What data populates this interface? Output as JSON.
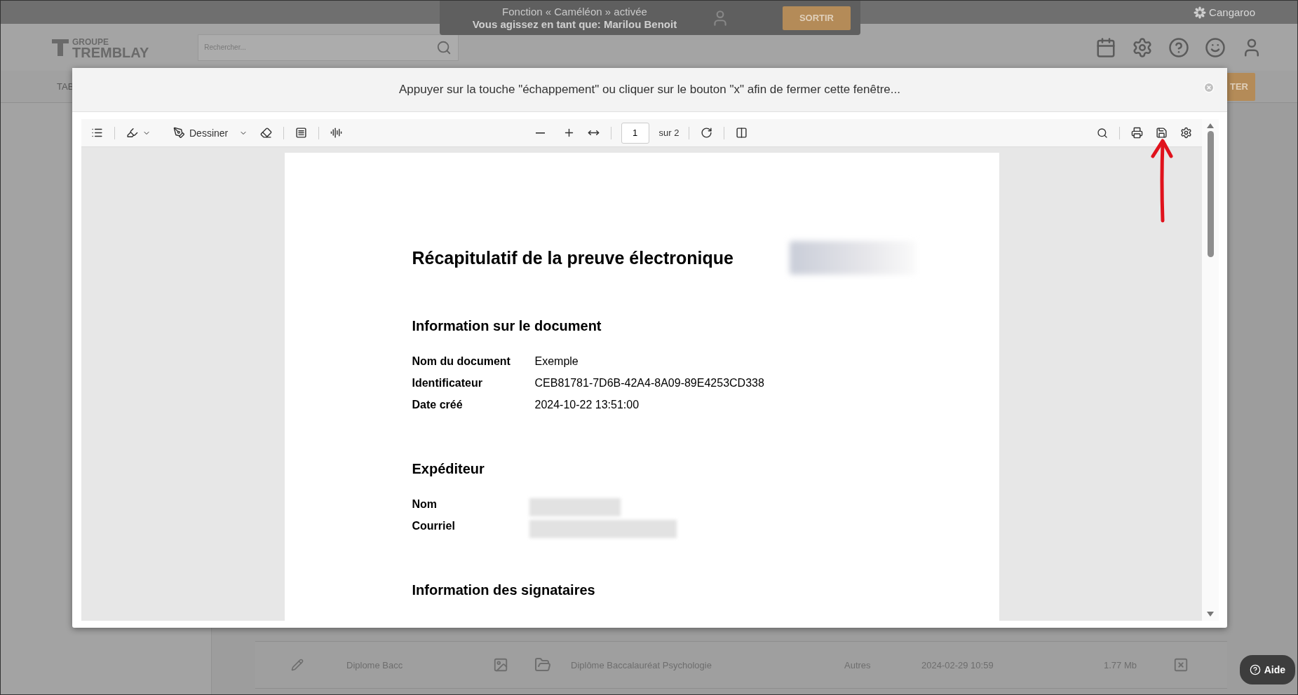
{
  "impersonation_banner": {
    "title": "Fonction « Caméléon » activée",
    "subtitle": "Vous agissez en tant que: Marilou Benoit",
    "button": "SORTIR"
  },
  "brand": "Cangaroo",
  "header": {
    "logo_top": "GROUPE",
    "logo_bottom": "TREMBLAY",
    "search": {
      "placeholder": "Rechercher..."
    }
  },
  "nav": {
    "tab_partial": "TAB",
    "action_partial": "TER"
  },
  "background_row": {
    "name": "Diplome Bacc",
    "description": "Diplôme Baccalauréat Psychologie",
    "category": "Autres",
    "date": "2024-02-29 10:59",
    "size": "1.77 Mb"
  },
  "help_button": "Aide",
  "modal": {
    "hint": "Appuyer sur la touche \"échappement\" ou cliquer sur le bouton \"x\" afin de fermer cette fenêtre...",
    "toolbar": {
      "draw_label": "Dessiner",
      "page_number": "1",
      "page_total": "sur 2"
    },
    "document": {
      "title": "Récapitulatif de la preuve électronique",
      "sections": [
        {
          "heading": "Information sur le document",
          "rows": [
            {
              "label": "Nom du document",
              "value": "Exemple"
            },
            {
              "label": "Identificateur",
              "value": "CEB81781-7D6B-42A4-8A09-89E4253CD338"
            },
            {
              "label": "Date créé",
              "value": "2024-10-22 13:51:00"
            }
          ]
        },
        {
          "heading": "Expéditeur",
          "rows": [
            {
              "label": "Nom",
              "redacted": true
            },
            {
              "label": "Courriel",
              "redacted": true
            }
          ]
        },
        {
          "heading": "Information des signataires"
        }
      ]
    }
  }
}
